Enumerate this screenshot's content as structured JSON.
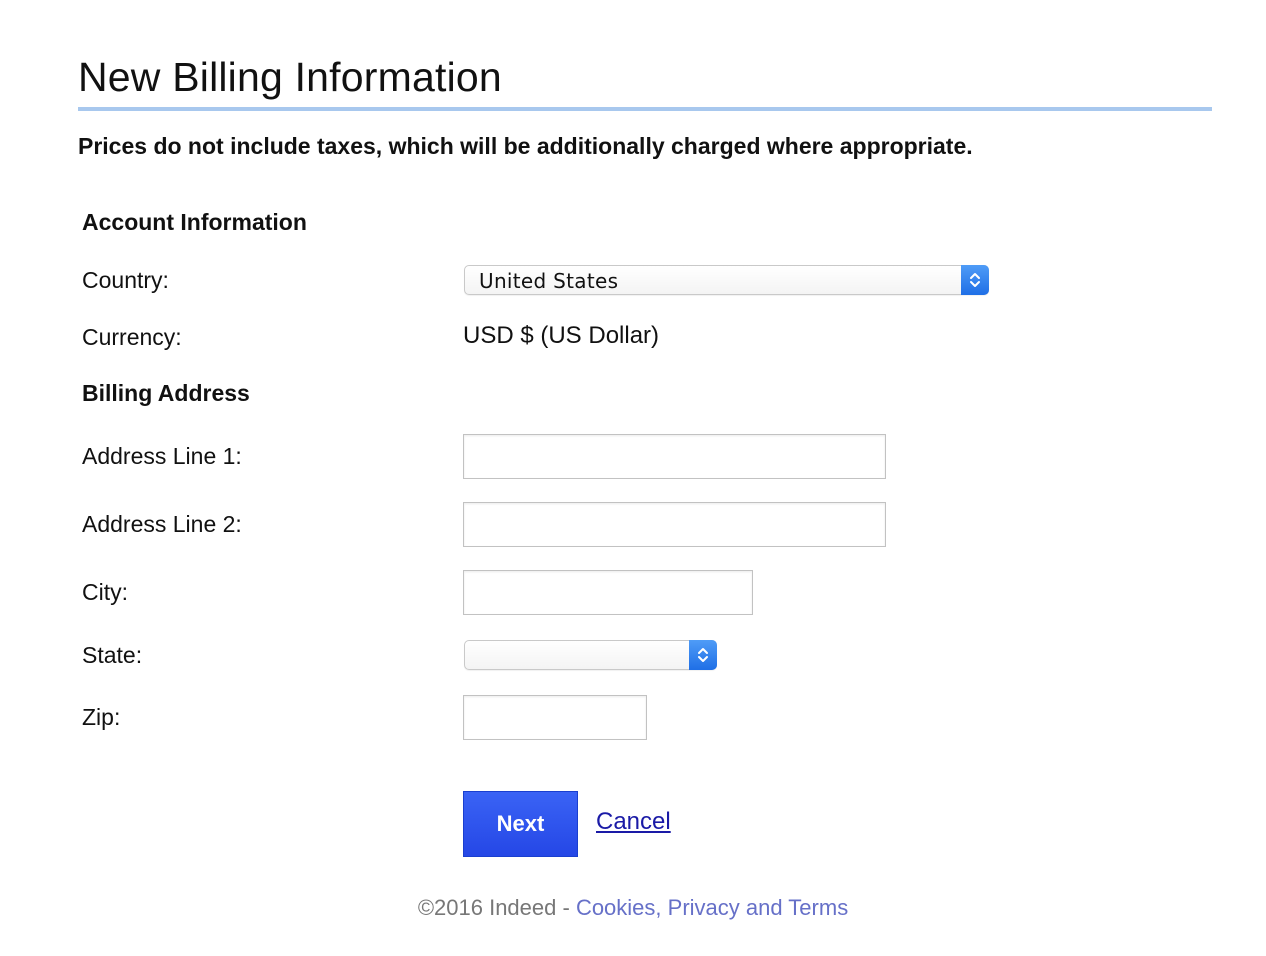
{
  "page": {
    "title": "New Billing Information",
    "tax_note": "Prices do not include taxes, which will be additionally charged where appropriate."
  },
  "account_information": {
    "heading": "Account Information",
    "country_label": "Country:",
    "country_value": "United States",
    "currency_label": "Currency:",
    "currency_value": "USD $ (US Dollar)"
  },
  "billing_address": {
    "heading": "Billing Address",
    "address_line_1_label": "Address Line 1:",
    "address_line_1_value": "",
    "address_line_2_label": "Address Line 2:",
    "address_line_2_value": "",
    "city_label": "City:",
    "city_value": "",
    "state_label": "State:",
    "state_value": "",
    "zip_label": "Zip:",
    "zip_value": ""
  },
  "actions": {
    "next_label": "Next",
    "cancel_label": "Cancel"
  },
  "footer": {
    "copyright": "©2016 Indeed",
    "separator": " - ",
    "terms_link": "Cookies, Privacy and Terms"
  },
  "colors": {
    "title_rule": "#a8c8ee",
    "button_blue": "#2547e6",
    "select_accent": "#1f6fe6",
    "link": "#1a1aa6",
    "footer_link": "#6670c8"
  },
  "icons": {
    "select_arrows": "up-down-chevron-icon"
  }
}
